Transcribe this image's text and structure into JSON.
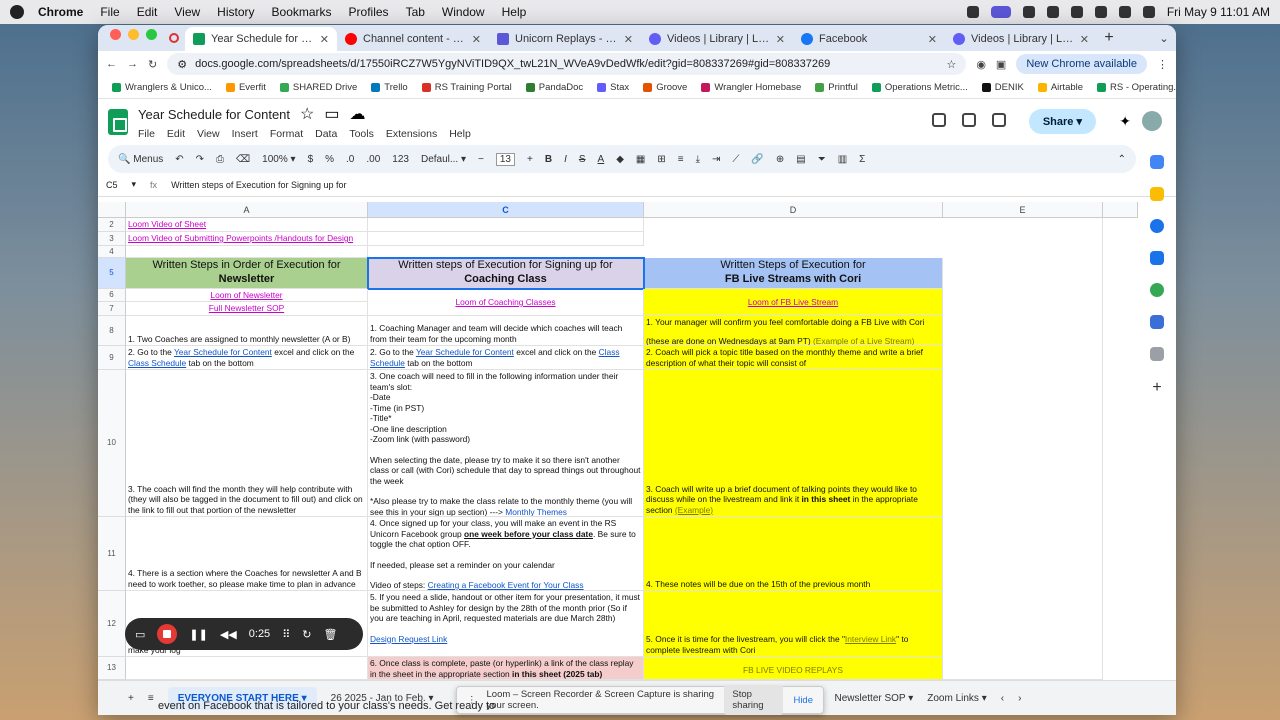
{
  "menubar": {
    "items": [
      "Chrome",
      "File",
      "Edit",
      "View",
      "History",
      "Bookmarks",
      "Profiles",
      "Tab",
      "Window",
      "Help"
    ],
    "datetime": "Fri May 9  11:01 AM"
  },
  "tabs": [
    {
      "title": "Year Schedule for Content - G",
      "active": true,
      "color": "#0f9d58"
    },
    {
      "title": "Channel content - YouTube S",
      "active": false,
      "color": "#ff0000"
    },
    {
      "title": "Unicorn Replays - Workout C",
      "active": false,
      "color": "#5b57d6"
    },
    {
      "title": "Videos | Library | Loom",
      "active": false,
      "color": "#625df5"
    },
    {
      "title": "Facebook",
      "active": false,
      "color": "#1877f2"
    },
    {
      "title": "Videos | Library | Loom",
      "active": false,
      "color": "#625df5"
    }
  ],
  "address": {
    "url": "docs.google.com/spreadsheets/d/17550iRCZ7W5YgyNViTID9QX_twL21N_WVeA9vDedWfk/edit?gid=808337269#gid=808337269",
    "new_chrome": "New Chrome available"
  },
  "bookmarks": [
    "Wranglers & Unico...",
    "Everfit",
    "SHARED Drive",
    "Trello",
    "RS Training Portal",
    "PandaDoc",
    "Stax",
    "Groove",
    "Wrangler Homebase",
    "Printful",
    "Operations Metric...",
    "DENIK",
    "Airtable",
    "RS - Operating..."
  ],
  "doc": {
    "title": "Year Schedule for Content",
    "menus": [
      "File",
      "Edit",
      "View",
      "Insert",
      "Format",
      "Data",
      "Tools",
      "Extensions",
      "Help"
    ],
    "share": "Share"
  },
  "toolbar": {
    "menus": "Menus",
    "zoom": "100%",
    "currency": "$",
    "percent": "%",
    "decimals_dec": ".0",
    "decimals_inc": ".00",
    "format123": "123",
    "font": "Defaul...",
    "font_size": "13"
  },
  "formula": {
    "cell_ref": "C5",
    "content": "Written steps of Execution for Signing up for"
  },
  "columns": [
    "A",
    "C",
    "D",
    "E"
  ],
  "rows": [
    "2",
    "3",
    "4",
    "5",
    "6",
    "7",
    "8",
    "9",
    "10",
    "11",
    "12",
    "13"
  ],
  "cells": {
    "a2": "Loom Video of Sheet",
    "a3": "Loom Video of Submitting Powerpoints /Handouts for Design",
    "a5_l1": "Written Steps in Order of Execution for",
    "a5_l2": "Newsletter",
    "c5_l1": "Written steps of Execution for Signing up for",
    "c5_l2": "Coaching Class",
    "d5_l1": "Written Steps of Execution for",
    "d5_l2": "FB Live Streams with Cori",
    "a6": "Loom of Newsletter",
    "a7": "Full Newsletter SOP",
    "c6": "Loom of Coaching Classes",
    "d6": "Loom of FB Live Stream",
    "a8": "1. Two Coaches are assigned to monthly newsletter (A or B)",
    "c8": "1. Coaching Manager and team will decide which coaches will teach from their team for the upcoming month",
    "d8_l1": "1. Your manager will confirm you feel comfortable doing a FB Live with Cori",
    "d8_l2": "(these are done on Wednesdays at 9am PT)",
    "d8_link": "(Example of a Live Stream)",
    "a9_pre": "2. Go to the",
    "a9_link": "Year Schedule for Content",
    "a9_mid": "excel and click on the",
    "a9_link2": "Class Schedule",
    "a9_post": "tab on the bottom",
    "c9_pre": "2. Go to the",
    "c9_link": "Year Schedule for Content",
    "c9_mid": "excel and click on the",
    "c9_link2": "Class Schedule",
    "c9_post": "tab on the bottom",
    "d9": "2. Coach will pick a topic title based on the monthly theme and write a brief description of what their topic will consist of",
    "c10_l1": "3. One coach will need to fill in the following information under their team's slot:",
    "c10_l2": "-Date",
    "c10_l3": "-Time (in PST)",
    "c10_l4": "-Title*",
    "c10_l5": "-One line description",
    "c10_l6": "-Zoom link (with password)",
    "c10_l7": "When selecting the date, please try to make it so there isn't another class or call (with Cori) schedule that day to spread things out throughout the week",
    "c10_l8": "*Also please try to make the class relate to the monthly theme (you will see this in your sign up section) --->",
    "c10_link": "Monthly Themes",
    "a10": "3. The coach will find the month they will help contribute with (they will also be tagged in the document to fill out) and click on the link to fill out that portion of the newsletter",
    "d10_pre": "3. Coach will write up a brief document of talking points they would like to discuss while on the livestream and link it",
    "d10_bold": "in this sheet",
    "d10_mid": "in the appropriate section",
    "d10_link": "(Example)",
    "c11_pre": "4. Once signed up for your class, you will make an event in the RS Unicorn Facebook group",
    "c11_bold": "one week before your class date",
    "c11_post": ". Be sure to toggle the chat option OFF.",
    "c11_l2": "If needed, please set a reminder on your calendar",
    "c11_l3": "Video of steps:",
    "c11_link": "Creating a Facebook Event for Your Class",
    "a11": "4. There is a section where the Coaches for newsletter A and B need to work toether, so please make time to plan in advance",
    "d11": "4. These notes will be due on the 15th of the previous month",
    "c12_l1": "5. If you need a slide, handout or other item for your presentation, it must be submitted to Ashley for design by the 28th of the month prior (So if you are teaching in April, requested materials are due March 28th)",
    "c12_link": "Design Request Link",
    "d12_pre": "5. Once it is time for the livestream, you will click the \"",
    "d12_link": "Interview Link",
    "d12_post": "\" to complete livestream with Cori",
    "a12_partial": "make your log",
    "c13_pre": "6. Once class is complete, paste (or hyperlink) a link of the class replay in the sheet in the appropriate section",
    "c13_bold": "in this sheet (2025 tab)",
    "d13": "FB LIVE VIDEO REPLAYS"
  },
  "sheet_tabs": {
    "active": "EVERYONE START HERE",
    "second_num": "26",
    "second": "2025 - Jan to Feb.",
    "partial": "25",
    "newsletter": "Newsletter SOP",
    "zoom": "Zoom Links"
  },
  "recorder": {
    "time": "0:25"
  },
  "loom_share": {
    "message": "Loom – Screen Recorder & Screen Capture is sharing your screen.",
    "stop": "Stop sharing",
    "hide": "Hide"
  },
  "background_text": "event on Facebook that is tailored to your class's needs. Get ready to"
}
